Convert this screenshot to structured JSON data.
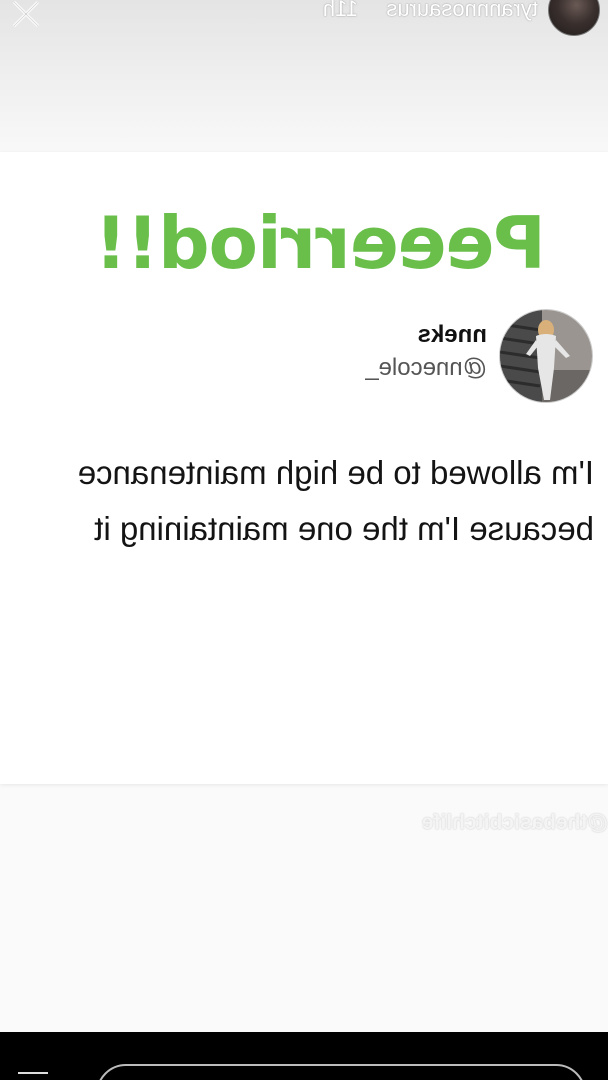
{
  "story": {
    "username": "tyrannnosaurus",
    "time": "11h"
  },
  "post": {
    "headline": "Peeerriod!!",
    "headline_color": "#6abf4b",
    "tweet": {
      "name": "nneks",
      "handle": "@nnecole_",
      "text_lines": [
        "I'm allowed to be high maintenance",
        "because I'm the one maintaining it"
      ]
    },
    "watermark": "@thebasicbitchlife"
  },
  "icons": {
    "close": "close-icon",
    "send": "send-icon"
  }
}
